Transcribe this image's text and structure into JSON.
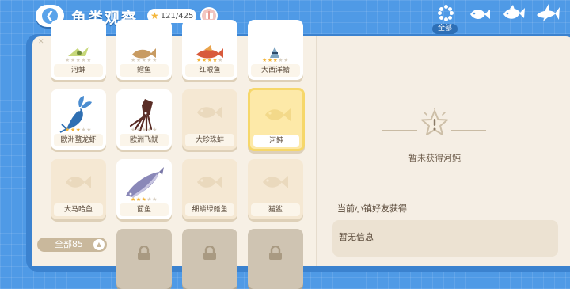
{
  "header": {
    "title": "鱼类观察",
    "counter": "121/425"
  },
  "filter": {
    "all_label": "全部"
  },
  "grid": {
    "row1": [
      {
        "name": "河蚌",
        "stars": 0
      },
      {
        "name": "鳕鱼",
        "stars": 0
      },
      {
        "name": "红眼鱼",
        "stars": 4
      },
      {
        "name": "大西洋鲭",
        "stars": 3
      }
    ],
    "row2": [
      {
        "name": "欧洲螯龙虾",
        "stars": 3,
        "state": "owned"
      },
      {
        "name": "欧洲飞鱿",
        "stars": 0,
        "state": "owned"
      },
      {
        "name": "大珍珠蚌",
        "stars": 0,
        "state": "unseen"
      },
      {
        "name": "河鲀",
        "stars": 0,
        "state": "selected"
      }
    ],
    "row3": [
      {
        "name": "大马哈鱼",
        "stars": 0,
        "state": "unseen"
      },
      {
        "name": "茴鱼",
        "stars": 3,
        "state": "owned"
      },
      {
        "name": "细鳞绿鳍鱼",
        "stars": 0,
        "state": "unseen"
      },
      {
        "name": "猫鲨",
        "stars": 0,
        "state": "unseen"
      }
    ]
  },
  "total_label": "全部85",
  "detail": {
    "status": "暂未获得河鲀",
    "friends_title": "当前小镇好友获得",
    "friends_info": "暂无信息"
  },
  "icons": [
    "back-arrow-icon",
    "star-icon",
    "gift-icon",
    "all-filter-icon",
    "small-fish-icon",
    "big-fish-icon",
    "shark-icon",
    "lock-icon",
    "fish-silhouette-icon"
  ],
  "colors": {
    "background": "#4f9ae6",
    "panel": "#f7f0e5",
    "selected_card": "#fde9a8",
    "star": "#f2b43a"
  }
}
